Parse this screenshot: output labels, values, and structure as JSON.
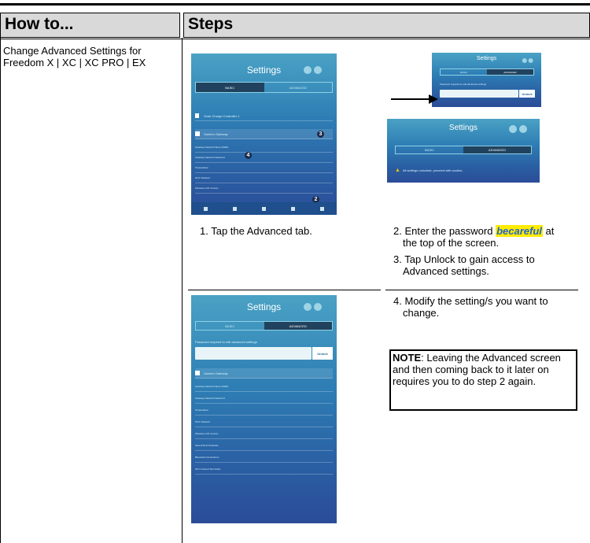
{
  "header": {
    "col1": "How to...",
    "col2": "Steps"
  },
  "howto": "Change Advanced Settings for Freedom X | XC | XC PRO | EX",
  "screens": {
    "first": {
      "title": "Settings",
      "tab_basic": "BASIC",
      "tab_advanced": "ADVANCED",
      "device": "Solar Charge Controller 1",
      "gateway": "Xantrex Gateway",
      "rows": [
        "Gateway Network Name (SSID)",
        "Gateway Network Password",
        "Temperature",
        "Wi-Fi Network",
        "Wireless LAN Country"
      ],
      "nav": [
        "System",
        "Devices",
        "Control",
        "Alarms",
        "Settings"
      ],
      "badge3": "3",
      "badge4": "4",
      "badge2": "2"
    },
    "second": {
      "title": "Settings",
      "tab_basic": "BASIC",
      "tab_advanced": "ADVANCED",
      "password_label": "Password required to edit advanced settings",
      "unlock": "Unlock"
    },
    "third": {
      "title": "Settings",
      "tab_basic": "BASIC",
      "tab_advanced": "ADVANCED",
      "message": "All settings unlocked, proceed with caution."
    },
    "fourth": {
      "title": "Settings",
      "tab_basic": "BASIC",
      "tab_advanced": "ADVANCED",
      "password_label": "Password required to edit advanced settings",
      "unlock": "Unlock",
      "gateway": "Xantrex Gateway",
      "rows": [
        "Gateway Network Name (SSID)",
        "Gateway Network Password",
        "Temperature",
        "Wi-Fi Network",
        "Wireless LAN Country",
        "Saved Wi-Fi Networks",
        "Bluetooth Connections",
        "Wi-C Internal Terminator"
      ]
    }
  },
  "steps": {
    "s1": "1. Tap the Advanced tab.",
    "s2_pre": "2. Enter the password ",
    "s2_pw": "becareful",
    "s2_post": " at",
    "s2_line2": "the top of the screen.",
    "s3_line1": "3. Tap Unlock to gain access to",
    "s3_line2": "Advanced settings.",
    "s4_line1": "4. Modify the setting/s you want to",
    "s4_line2": "change."
  },
  "note": {
    "label": "NOTE",
    "text": ": Leaving the Advanced screen and then coming back to it later on requires you to do step 2 again."
  }
}
